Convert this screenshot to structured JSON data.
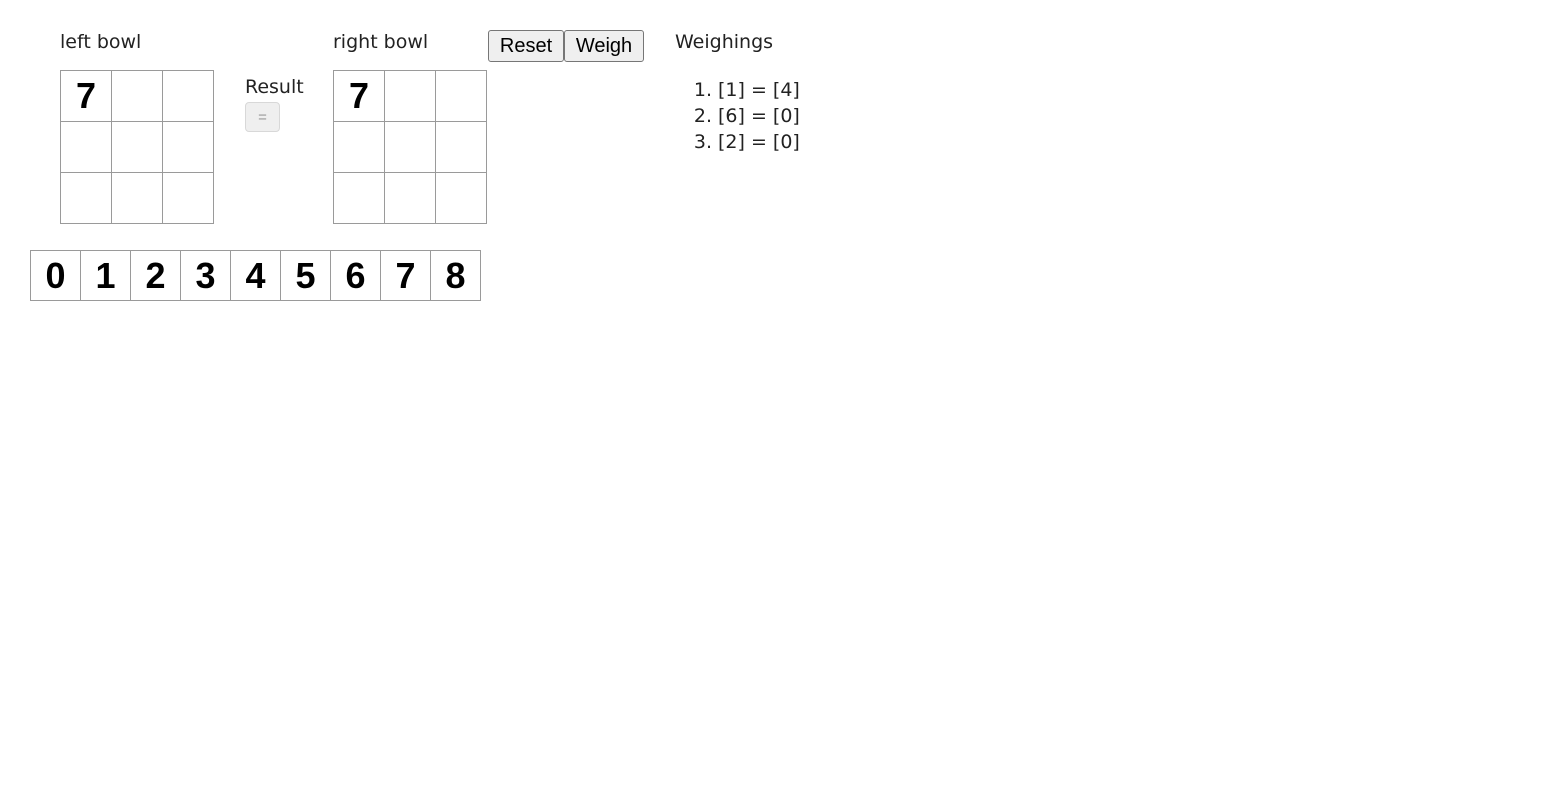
{
  "left_bowl": {
    "label": "left bowl",
    "cells": [
      "7",
      "",
      "",
      "",
      "",
      "",
      "",
      "",
      ""
    ]
  },
  "right_bowl": {
    "label": "right bowl",
    "cells": [
      "7",
      "",
      "",
      "",
      "",
      "",
      "",
      "",
      ""
    ]
  },
  "result": {
    "label": "Result",
    "value": "="
  },
  "buttons": {
    "reset": "Reset",
    "weigh": "Weigh"
  },
  "weighings": {
    "title": "Weighings",
    "items": [
      {
        "num": "1.",
        "text": "[1] = [4]"
      },
      {
        "num": "2.",
        "text": "[6] = [0]"
      },
      {
        "num": "3.",
        "text": "[2] = [0]"
      }
    ]
  },
  "coins": [
    "0",
    "1",
    "2",
    "3",
    "4",
    "5",
    "6",
    "7",
    "8"
  ]
}
